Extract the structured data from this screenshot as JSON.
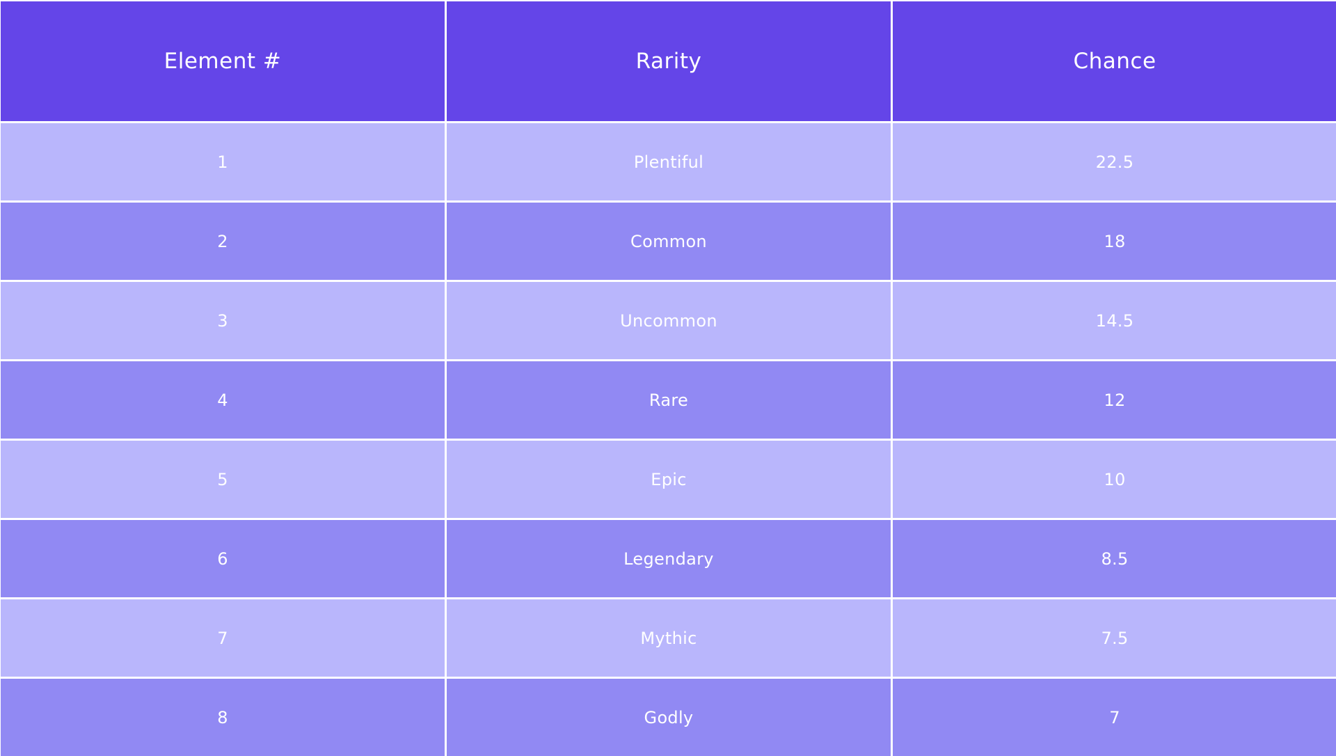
{
  "table": {
    "headers": [
      "Element #",
      "Rarity",
      "Chance"
    ],
    "rows": [
      [
        "1",
        "Plentiful",
        "22.5"
      ],
      [
        "2",
        "Common",
        "18"
      ],
      [
        "3",
        "Uncommon",
        "14.5"
      ],
      [
        "4",
        "Rare",
        "12"
      ],
      [
        "5",
        "Epic",
        "10"
      ],
      [
        "6",
        "Legendary",
        "8.5"
      ],
      [
        "7",
        "Mythic",
        "7.5"
      ],
      [
        "8",
        "Godly",
        "7"
      ]
    ]
  },
  "colors": {
    "header": "#6445e8",
    "row_light": "#b9b6fc",
    "row_dark": "#9189f3",
    "text": "#ffffff",
    "grid": "#ffffff"
  }
}
